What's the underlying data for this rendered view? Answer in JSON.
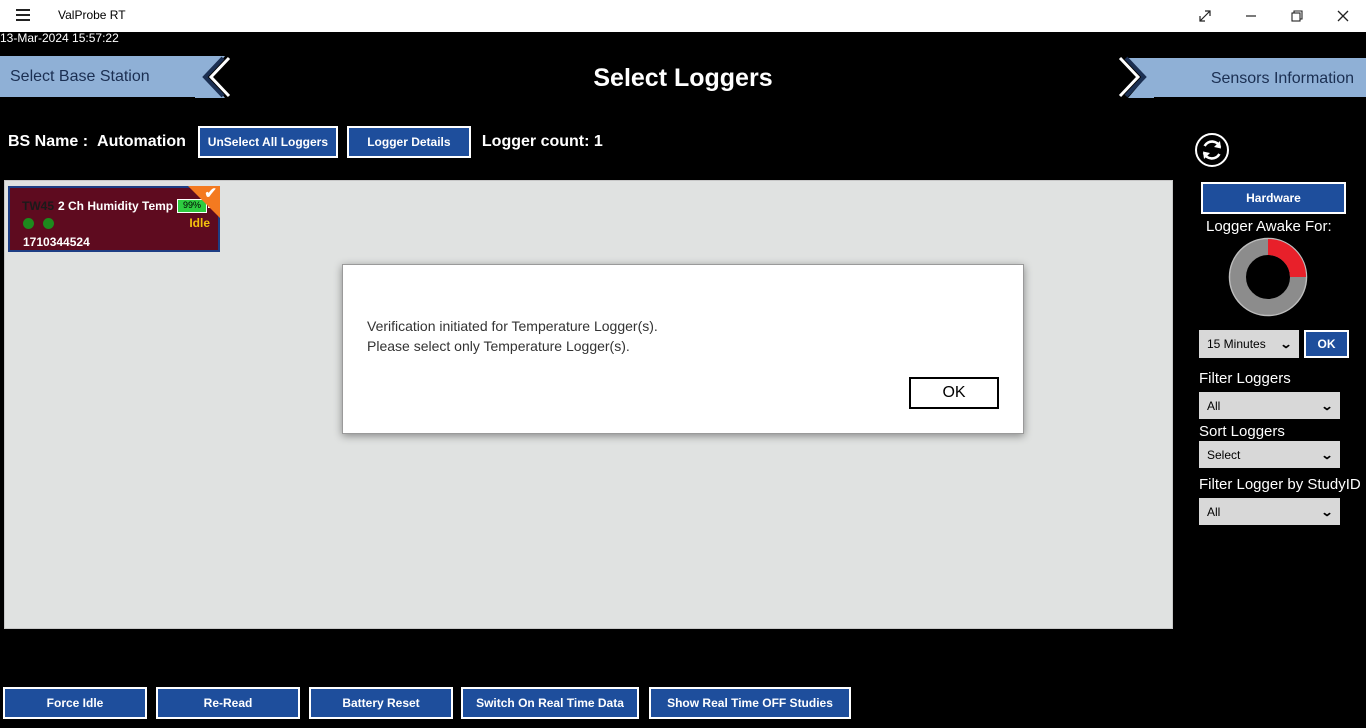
{
  "window": {
    "title": "ValProbe RT",
    "icons": {
      "menu": "hamburger-icon",
      "fullscreen": "expand-icon",
      "minimize": "minimize-icon",
      "restore": "restore-icon",
      "close": "close-icon"
    }
  },
  "timestamp": "13-Mar-2024 15:57:22",
  "nav": {
    "left_label": "Select Base Station",
    "page_title": "Select Loggers",
    "right_label": "Sensors Information"
  },
  "toolbar": {
    "bs_name_label": "BS Name :",
    "bs_name_value": "Automation",
    "unselect_label": "UnSelect All Loggers",
    "details_label": "Logger Details",
    "count_label": "Logger count: 1"
  },
  "logger": {
    "id": "TW45",
    "name": "2 Ch Humidity Temp",
    "battery": "99%",
    "status": "Idle",
    "serial": "1710344524"
  },
  "dialog": {
    "line1": "Verification initiated for Temperature Logger(s).",
    "line2": "Please select only Temperature Logger(s).",
    "ok_label": "OK"
  },
  "sidebar": {
    "hardware_label": "Hardware",
    "awake_label": "Logger Awake For:",
    "awake_fraction": 0.25,
    "awake_value": "15 Minutes",
    "awake_ok_label": "OK",
    "filter_label": "Filter Loggers",
    "filter_value": "All",
    "sort_label": "Sort Loggers",
    "sort_value": "Select",
    "study_label": "Filter Logger by StudyID",
    "study_value": "All"
  },
  "bottom": {
    "force_idle": "Force Idle",
    "re_read": "Re-Read",
    "battery_reset": "Battery Reset",
    "realtime_on": "Switch On Real Time Data",
    "realtime_off": "Show Real Time OFF Studies"
  },
  "colors": {
    "accent_blue": "#1e4e9c",
    "nav_blue": "#8fb0d6",
    "card_bg": "#5e0b1f",
    "check_orange": "#f47a20",
    "status_yellow": "#f4c20d",
    "gauge_red": "#e8202a"
  }
}
